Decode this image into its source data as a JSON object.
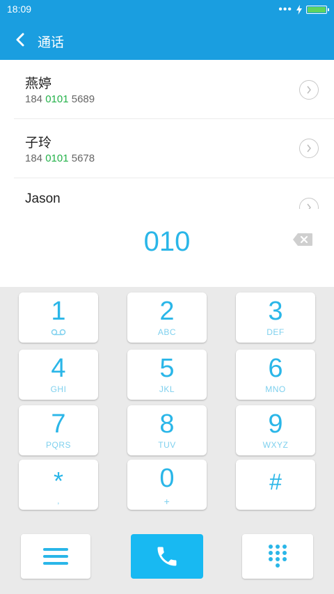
{
  "status_bar": {
    "time": "18:09",
    "dots": "•••"
  },
  "app_bar": {
    "title": "通话"
  },
  "contacts": [
    {
      "name": "燕婷",
      "number_prefix": "184 ",
      "number_match": "0101",
      "number_suffix": " 5689"
    },
    {
      "name": "子玲",
      "number_prefix": "184 ",
      "number_match": "0101",
      "number_suffix": " 5678"
    },
    {
      "name": "Jason"
    }
  ],
  "dialed_number": "010",
  "keys": [
    {
      "digit": "1"
    },
    {
      "digit": "2",
      "letters": "ABC"
    },
    {
      "digit": "3",
      "letters": "DEF"
    },
    {
      "digit": "4",
      "letters": "GHI"
    },
    {
      "digit": "5",
      "letters": "JKL"
    },
    {
      "digit": "6",
      "letters": "MNO"
    },
    {
      "digit": "7",
      "letters": "PQRS"
    },
    {
      "digit": "8",
      "letters": "TUV"
    },
    {
      "digit": "9",
      "letters": "WXYZ"
    },
    {
      "symbol": "*",
      "letters": ","
    },
    {
      "digit": "0",
      "letters": "+"
    },
    {
      "symbol": "#"
    }
  ],
  "colors": {
    "accent": "#1a9ee0",
    "digit": "#2ab6e8",
    "match": "#24b24a",
    "call_button": "#18b9f2"
  },
  "icons": {
    "back": "chevron-left-icon",
    "detail": "chevron-right-icon",
    "backspace": "backspace-icon",
    "voicemail": "voicemail-icon",
    "menu": "menu-icon",
    "call": "phone-icon",
    "keypad": "dialpad-icon"
  }
}
